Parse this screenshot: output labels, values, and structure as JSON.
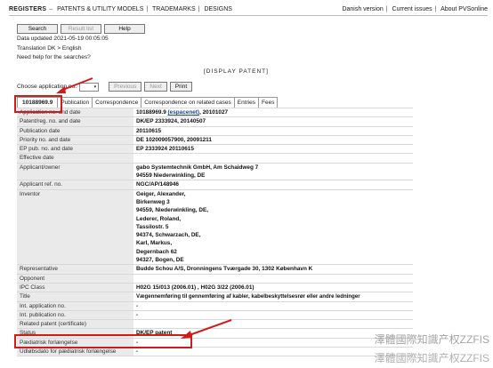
{
  "topbar": {
    "left": [
      "REGISTERS",
      "PATENTS & UTILITY MODELS",
      "TRADEMARKS",
      "DESIGNS"
    ],
    "right": [
      "Danish version",
      "Current issues",
      "About PVSonline"
    ]
  },
  "buttons": {
    "search": "Search",
    "result_list": "Result list",
    "help": "Help"
  },
  "info": {
    "updated": "Data updated 2021-05-19 00:05:05",
    "translation": "Translation DK > English",
    "need_help": "Need help for the searches?"
  },
  "banner": "[DISPLAY PATENT]",
  "choose": {
    "label": "Choose application no.",
    "previous": "Previous",
    "next": "Next",
    "print": "Print"
  },
  "tabs": [
    "10188969.9",
    "Publication",
    "Correspondence",
    "Correspondence on related cases",
    "Entries",
    "Fees"
  ],
  "rows": [
    {
      "label": "Application no. and date",
      "value": "10188969.9 ",
      "link": "(espacenet)",
      "after": ", 20101027"
    },
    {
      "label": "Patent/reg. no. and date",
      "value": "DK/EP 2333924, 20140507"
    },
    {
      "label": "Publication date",
      "value": "20110615"
    },
    {
      "label": "Priority no. and date",
      "value": "DE 102009057900, 20091211"
    },
    {
      "label": "EP pub. no. and date",
      "value": "EP 2333924 20110615"
    },
    {
      "label": "Effective date",
      "value": ""
    },
    {
      "label": "Applicant/owner",
      "lines": [
        "gabo Systemtechnik GmbH, Am Schaidweg 7",
        "94559 Niederwinkling, DE"
      ]
    },
    {
      "label": "Applicant ref. no.",
      "value": "NGC/AP/148946"
    },
    {
      "label": "Inventor",
      "lines": [
        "Geiger, Alexander,",
        "Birkenweg 3",
        "94559, Niederwinkling, DE,",
        "Lederer, Roland,",
        "Tassilostr. 5",
        "94374, Schwarzach, DE,",
        "Karl, Markus,",
        "Degernbach 62",
        "94327, Bogen, DE"
      ]
    },
    {
      "label": "Representative",
      "value": "Budde Schou A/S, Dronningens Tværgade 30, 1302 København K"
    },
    {
      "label": "Opponent",
      "value": ""
    },
    {
      "label": "IPC Class",
      "value": "H02G 15/013 (2006.01) , H02G 3/22 (2006.01)"
    },
    {
      "label": "Title",
      "value": "Vægennemføring til gennemføring af kabler, kabelbeskyttelsesrør eller andre ledninger"
    },
    {
      "label": "Int. application no.",
      "value": "-"
    },
    {
      "label": "Int. publication no.",
      "value": "-"
    },
    {
      "label": "Related patent (certificate)",
      "value": ""
    },
    {
      "label": "Status",
      "value": "DK/EP patent"
    },
    {
      "label": "Pædiatrisk forlængelse",
      "value": "-"
    },
    {
      "label": "Udløbsdato for pædiatrisk forlængelse",
      "value": "-"
    }
  ],
  "watermark": "澤體國際知識产权ZZFIS",
  "colors": {
    "highlight": "#d11a1a",
    "label_bg": "#eaeaea"
  }
}
